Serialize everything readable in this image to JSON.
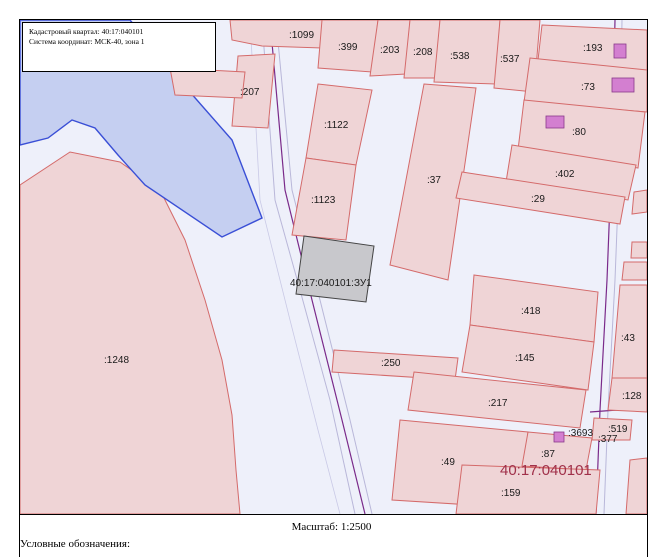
{
  "info": {
    "quarter_line": "Кадастровый квартал: 40:17:040101",
    "crs_line": "Система координат: МСК-40, зона 1"
  },
  "map": {
    "colors": {
      "background": "#eef0fa",
      "parcel_fill": "#efd4d6",
      "parcel_stroke": "#d46a6a",
      "water_fill": "#c5cff1",
      "water_stroke": "#3a4fd6",
      "selected_fill": "#c8c8cc",
      "selected_stroke": "#444444",
      "building_fill": "#d37fd0",
      "road_line": "#7a2a8a"
    },
    "parcel_labels": {
      "p1099": ":1099",
      "p399": ":399",
      "p203": ":203",
      "p208": ":208",
      "p538": ":538",
      "p537": ":537",
      "p193": ":193",
      "p73": ":73",
      "p207": ":207",
      "p1122": ":1122",
      "p80": ":80",
      "p37": ":37",
      "p402": ":402",
      "p29": ":29",
      "p1123": ":1123",
      "p418": ":418",
      "p43": ":43",
      "p1248": ":1248",
      "p250": ":250",
      "p145": ":145",
      "p217": ":217",
      "p128": ":128",
      "p519": ":519",
      "p3693": ":3693",
      "p377": ":377",
      "p87": ":87",
      "p49": ":49",
      "p159": ":159"
    },
    "selected_parcel_label": "40:17:040101:ЗУ1",
    "quarter_label": "40:17:040101"
  },
  "footer": {
    "scale": "Масштаб: 1:2500",
    "legend_title": "Условные обозначения:"
  }
}
